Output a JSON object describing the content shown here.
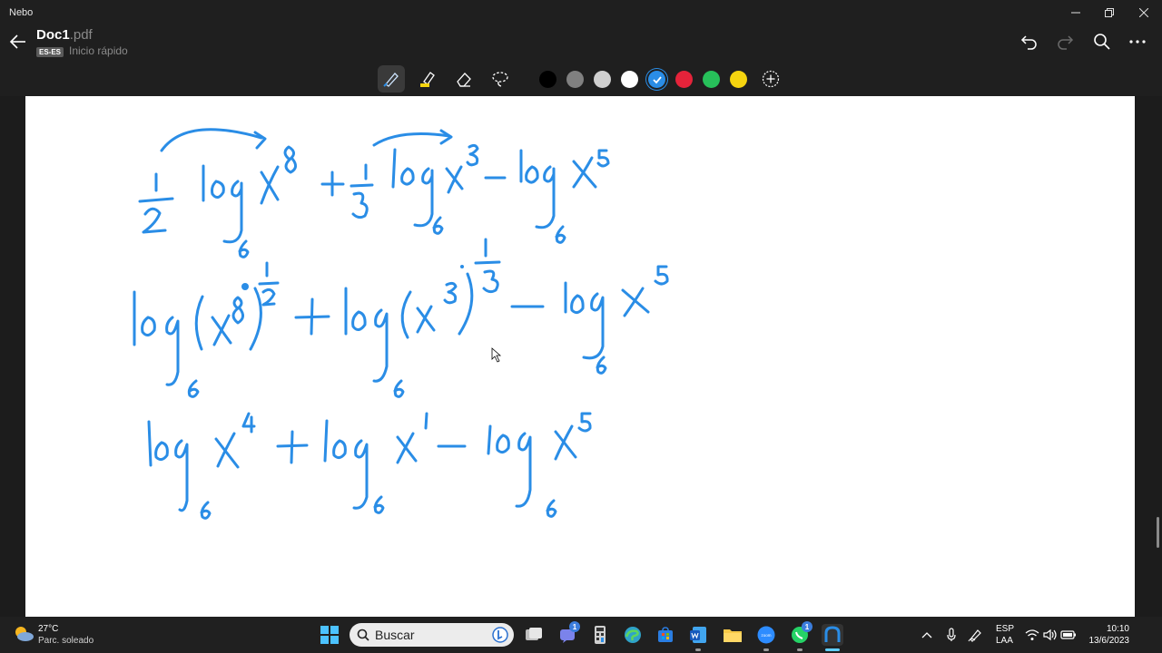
{
  "window": {
    "app_name": "Nebo"
  },
  "header": {
    "doc_name": "Doc1",
    "doc_ext": ".pdf",
    "language_badge": "ES-ES",
    "subtitle": "Inicio rápido"
  },
  "toolbar": {
    "tools": [
      "pen-icon",
      "highlighter-icon",
      "eraser-icon",
      "lasso-icon"
    ],
    "colors": [
      "#000000",
      "#808080",
      "#cfcfcf",
      "#ffffff",
      "#2a8de6",
      "#e5233a",
      "#27c05a",
      "#f5d40f"
    ],
    "selected_color": "#2a8de6",
    "add_color": "add-color-icon"
  },
  "document": {
    "ink_color": "#2a8de6",
    "handwritten_lines": [
      "1/2 log_6 X^8 + 1/3 log_6 X^3 - log_6 X^5",
      "log_6 (X^8)^(1/2) + log_6 (X^3)^(1/3) - log_6 X^5",
      "log_6 X^4 + log_6 X^1 - log_6 X^5"
    ]
  },
  "taskbar": {
    "weather": {
      "temp": "27°C",
      "desc": "Parc. soleado"
    },
    "search_placeholder": "Buscar",
    "teams_badge": "1",
    "whatsapp_badge": "1",
    "language_line1": "ESP",
    "language_line2": "LAA",
    "time": "10:10",
    "date": "13/6/2023"
  }
}
